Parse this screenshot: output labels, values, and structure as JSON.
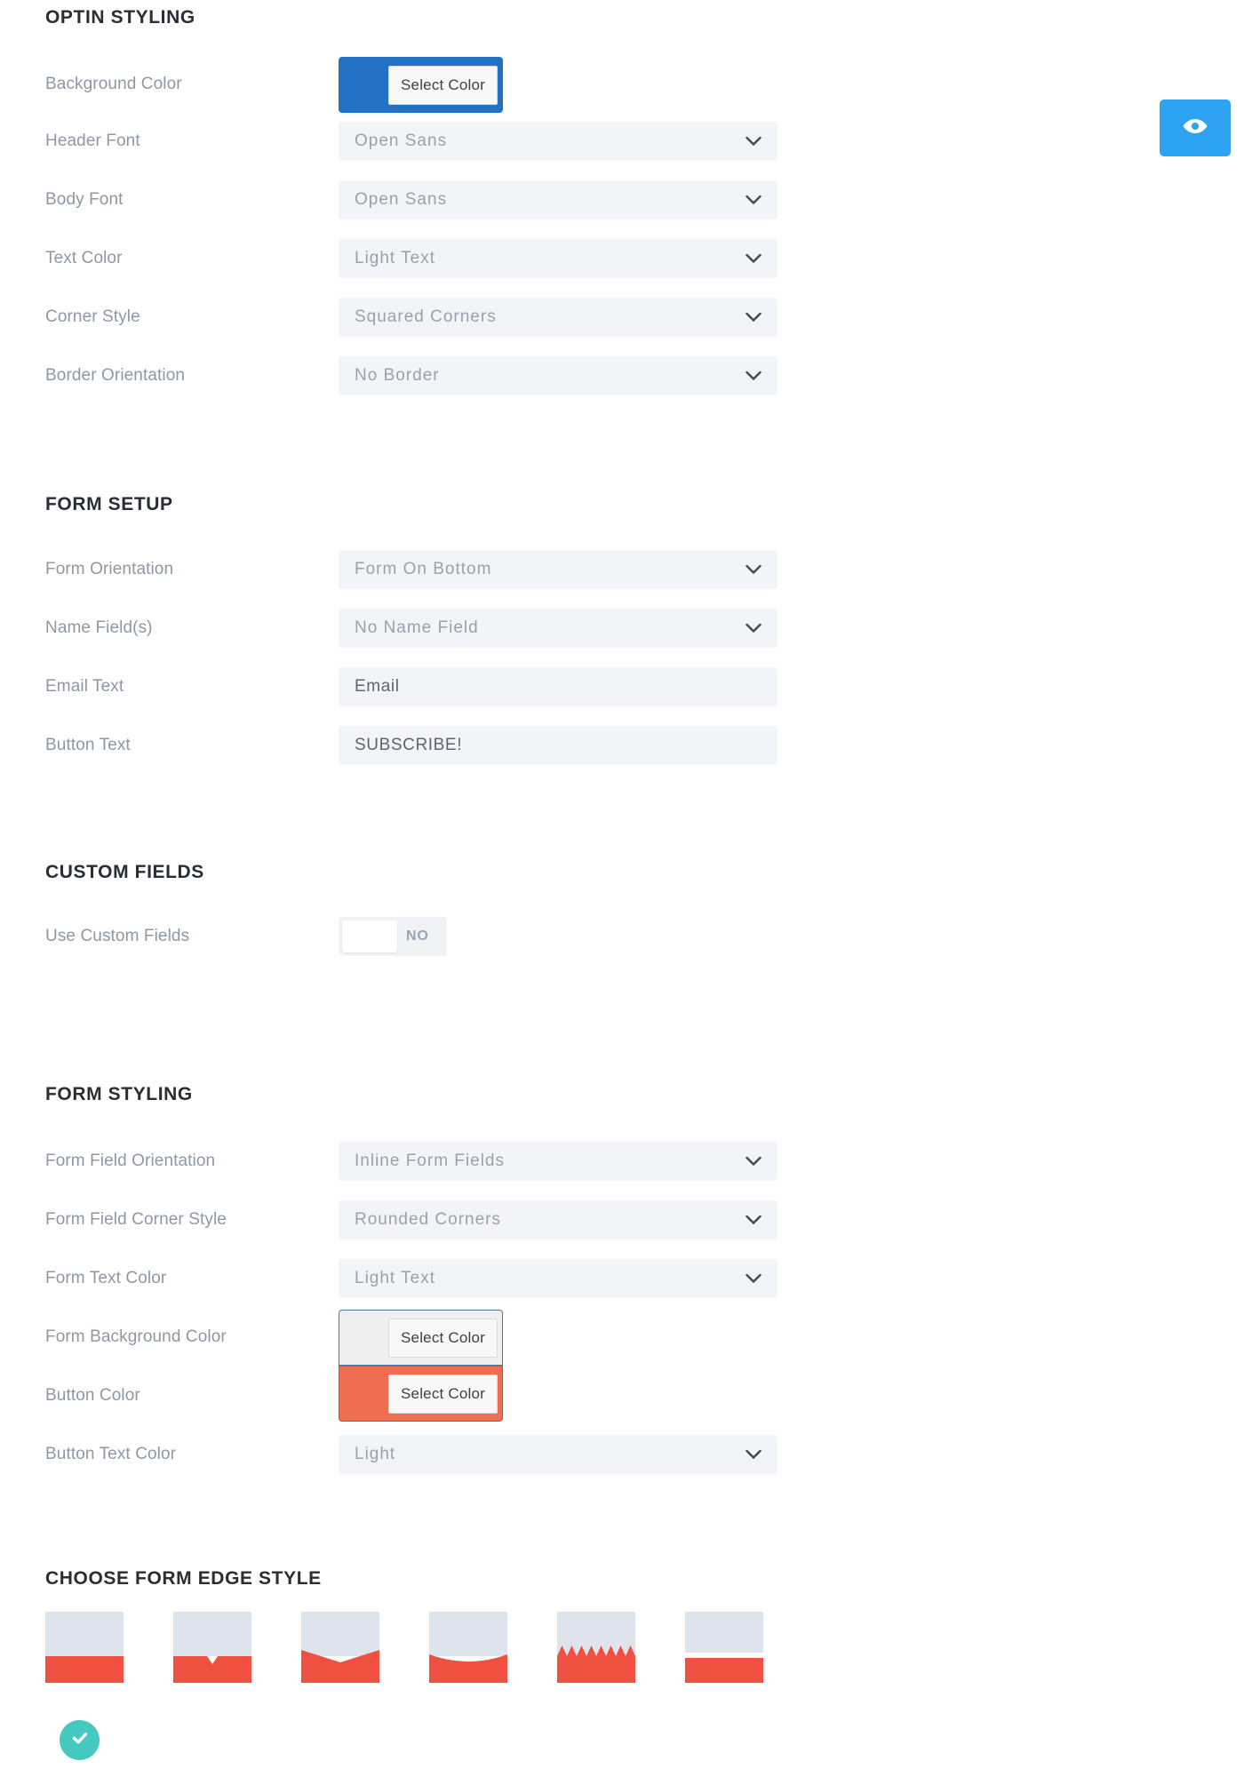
{
  "sections": [
    {
      "title": "OPTIN STYLING",
      "rows": [
        {
          "label": "Background Color",
          "type": "color",
          "swatch_color": "#2271c4",
          "button_label": "Select Color"
        },
        {
          "label": "Header Font",
          "type": "select",
          "value": "Open Sans"
        },
        {
          "label": "Body Font",
          "type": "select",
          "value": "Open Sans"
        },
        {
          "label": "Text Color",
          "type": "select",
          "value": "Light Text"
        },
        {
          "label": "Corner Style",
          "type": "select",
          "value": "Squared Corners"
        },
        {
          "label": "Border Orientation",
          "type": "select",
          "value": "No Border"
        }
      ]
    },
    {
      "title": "FORM SETUP",
      "rows": [
        {
          "label": "Form Orientation",
          "type": "select",
          "value": "Form On Bottom"
        },
        {
          "label": "Name Field(s)",
          "type": "select",
          "value": "No Name Field"
        },
        {
          "label": "Email Text",
          "type": "text",
          "value": "Email"
        },
        {
          "label": "Button Text",
          "type": "text",
          "value": "SUBSCRIBE!"
        }
      ]
    },
    {
      "title": "CUSTOM FIELDS",
      "rows": [
        {
          "label": "Use Custom Fields",
          "type": "toggle",
          "value": "NO"
        }
      ]
    },
    {
      "title": "FORM STYLING",
      "rows": [
        {
          "label": "Form Field Orientation",
          "type": "select",
          "value": "Inline Form Fields"
        },
        {
          "label": "Form Field Corner Style",
          "type": "select",
          "value": "Rounded Corners"
        },
        {
          "label": "Form Text Color",
          "type": "select",
          "value": "Light Text"
        },
        {
          "label": "Form Background Color",
          "type": "color",
          "swatch_color": "#efeff0",
          "button_label": "Select Color"
        },
        {
          "label": "Button Color",
          "type": "color",
          "swatch_color": "#ef6d50",
          "button_label": "Select Color"
        },
        {
          "label": "Button Text Color",
          "type": "select",
          "value": "Light"
        }
      ]
    },
    {
      "title": "CHOOSE FORM EDGE STYLE",
      "rows": []
    }
  ],
  "labels": {
    "optin_styling": "OPTIN STYLING",
    "background_color": "Background Color",
    "header_font": "Header Font",
    "body_font": "Body Font",
    "text_color": "Text Color",
    "corner_style": "Corner Style",
    "border_orientation": "Border Orientation",
    "form_setup": "FORM SETUP",
    "form_orientation": "Form Orientation",
    "name_fields": "Name Field(s)",
    "email_text": "Email Text",
    "button_text": "Button Text",
    "custom_fields": "CUSTOM FIELDS",
    "use_custom_fields": "Use Custom Fields",
    "form_styling": "FORM STYLING",
    "form_field_orientation": "Form Field Orientation",
    "form_field_corner_style": "Form Field Corner Style",
    "form_text_color": "Form Text Color",
    "form_background_color": "Form Background Color",
    "button_color": "Button Color",
    "button_text_color": "Button Text Color",
    "choose_form_edge_style": "CHOOSE FORM EDGE STYLE"
  },
  "values": {
    "header_font": "Open Sans",
    "body_font": "Open Sans",
    "text_color": "Light Text",
    "corner_style": "Squared Corners",
    "border_orientation": "No Border",
    "form_orientation": "Form On Bottom",
    "name_fields": "No Name Field",
    "email_text": "Email",
    "button_text": "SUBSCRIBE!",
    "use_custom_fields": "NO",
    "form_field_orientation": "Inline Form Fields",
    "form_field_corner_style": "Rounded Corners",
    "form_text_color": "Light Text",
    "button_text_color": "Light"
  },
  "color_pickers": {
    "background": {
      "button_label": "Select Color",
      "color": "#2271c4"
    },
    "form_background": {
      "button_label": "Select Color",
      "color": "#efeff0"
    },
    "button": {
      "button_label": "Select Color",
      "color": "#ef6d50"
    }
  },
  "edge_styles": {
    "options": [
      {
        "name": "flat-edge"
      },
      {
        "name": "notch-edge"
      },
      {
        "name": "wide-v-edge"
      },
      {
        "name": "curve-edge"
      },
      {
        "name": "zigzag-edge"
      },
      {
        "name": "gap-edge"
      }
    ],
    "selected_index": 0,
    "top_color": "#dfe3ec",
    "bottom_color": "#f0503f"
  },
  "colors": {
    "accent_blue": "#2ea3f2",
    "swatch_blue": "#2271c4",
    "swatch_coral": "#ef6d50",
    "edge_red": "#f0503f",
    "edge_gray": "#dfe3ec",
    "check_teal": "#45c8c0",
    "field_bg": "#f3f4f7",
    "label_gray": "#8f97a5",
    "heading_dark": "#2b2d35"
  },
  "icons": {
    "eye": "eye-icon",
    "chevron": "chevron-down-icon",
    "check": "check-icon"
  }
}
